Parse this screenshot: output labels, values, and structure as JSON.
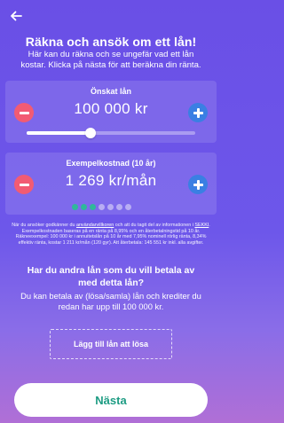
{
  "header": {
    "title": "Räkna och ansök om ett lån!",
    "subtitle": "Här kan du räkna och se ungefär vad ett lån kostar. Klicka på nästa för att beräkna din ränta."
  },
  "loan_card": {
    "label": "Önskat lån",
    "amount": "100 000 kr",
    "slider_fraction": 0.38
  },
  "cost_card": {
    "label": "Exempelkostnad (10 år)",
    "amount": "1 269 kr/mån",
    "dots_total": 7,
    "dots_active": 3
  },
  "fineprint": {
    "pre_link1": "När du ansöker godkänner du ",
    "link1": "användarvillkoren",
    "mid1": " och att du tagit del av informationen i ",
    "link2": "SEKKI",
    "rest": ". Exempelkostnaden baseras på en ränta på 8,95% och en återbetalningstid på 10 år. Räkneexempel: 100 000 kr i annuitetslån på 10 år med 7,95% nominell rörlig ränta, 8,34% effektiv ränta, kostar 1 211 kr/mån (120 gyr). Att återbetala: 145 551 kr inkl. alla avgifter."
  },
  "consolidate": {
    "title": "Har du andra lån som du vill betala av med detta lån?",
    "body": "Du kan betala av (lösa/samla) lån och krediter du redan har upp till 100 000 kr.",
    "button_label": "Lägg till lån att lösa"
  },
  "footer": {
    "next_label": "Nästa"
  },
  "colors": {
    "background_top": "#6a4fe6",
    "minus_button": "#f25b73",
    "plus_button": "#3a7fe3",
    "active_dot": "#2fb89a",
    "next_text": "#1d9c83"
  }
}
